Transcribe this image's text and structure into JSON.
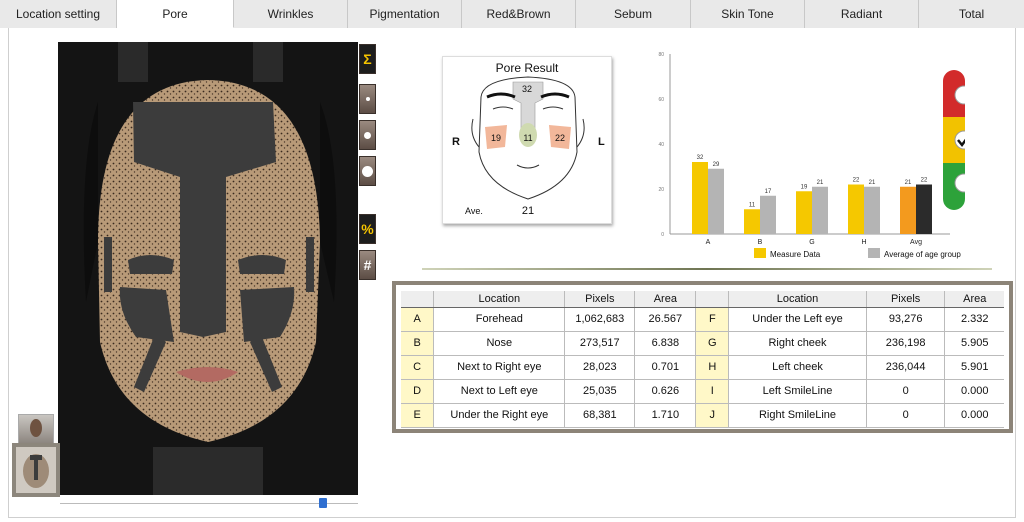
{
  "tabs": [
    {
      "label": "Location setting"
    },
    {
      "label": "Pore"
    },
    {
      "label": "Wrinkles"
    },
    {
      "label": "Pigmentation"
    },
    {
      "label": "Red&Brown"
    },
    {
      "label": "Sebum"
    },
    {
      "label": "Skin Tone"
    },
    {
      "label": "Radiant"
    },
    {
      "label": "Total"
    }
  ],
  "active_tab": "Pore",
  "tools": {
    "sum": "Σ",
    "percent": "%",
    "hash": "#"
  },
  "pore_result": {
    "title": "Pore Result",
    "forehead": "32",
    "right_cheek": "19",
    "nose": "11",
    "left_cheek": "22",
    "right_label": "R",
    "left_label": "L",
    "ave_label": "Ave.",
    "ave_value": "21"
  },
  "chart_data": {
    "type": "bar",
    "categories": [
      "A",
      "B",
      "G",
      "H",
      "Avg"
    ],
    "series": [
      {
        "name": "Measure Data",
        "values": [
          32,
          11,
          19,
          22,
          21
        ]
      },
      {
        "name": "Average of age group",
        "values": [
          29,
          17,
          21,
          21,
          22
        ]
      }
    ],
    "ylim": [
      0,
      80
    ],
    "yticks": [
      "0",
      "20",
      "40",
      "60",
      "80"
    ],
    "colors": {
      "measure": "#f5c800",
      "average": "#b4b4b4",
      "avg_measure": "#f39a1e",
      "avg_average": "#2b2b2b"
    },
    "legend_position": "bottom"
  },
  "table": {
    "headers": [
      "",
      "Location",
      "Pixels",
      "Area",
      "",
      "Location",
      "Pixels",
      "Area"
    ],
    "rows": [
      [
        "A",
        "Forehead",
        "1,062,683",
        "26.567",
        "F",
        "Under the Left eye",
        "93,276",
        "2.332"
      ],
      [
        "B",
        "Nose",
        "273,517",
        "6.838",
        "G",
        "Right cheek",
        "236,198",
        "5.905"
      ],
      [
        "C",
        "Next to Right eye",
        "28,023",
        "0.701",
        "H",
        "Left cheek",
        "236,044",
        "5.901"
      ],
      [
        "D",
        "Next to Left eye",
        "25,035",
        "0.626",
        "I",
        "Left SmileLine",
        "0",
        "0.000"
      ],
      [
        "E",
        "Under the Right eye",
        "68,381",
        "1.710",
        "J",
        "Right SmileLine",
        "0",
        "0.000"
      ]
    ]
  },
  "traffic_light_colors": {
    "red": "#d22b2b",
    "yellow": "#f2c200",
    "green": "#2da23a"
  },
  "slider": {
    "value_fraction": 0.88
  }
}
